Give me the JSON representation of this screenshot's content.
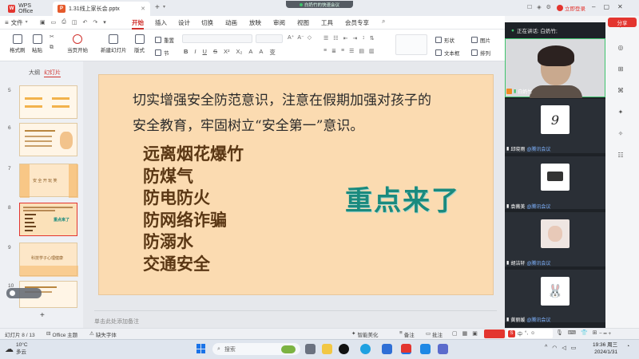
{
  "titlebar": {
    "app_tab": "WPS Office",
    "file_tab": "1.31线上家长会.pptx",
    "meeting_banner": "白奶竹的快速会议",
    "login": "立即登录",
    "share": "分享"
  },
  "menubar": {
    "file": "文件",
    "items": [
      "开始",
      "插入",
      "设计",
      "切换",
      "动画",
      "放映",
      "审阅",
      "视图",
      "工具",
      "会员专享"
    ]
  },
  "ribbon": {
    "format_painter": "格式刷",
    "paste": "粘贴",
    "from_current": "当页开始",
    "new_slide": "新建幻灯片",
    "layout": "版式",
    "reset": "重置",
    "section": "节",
    "shape": "形状",
    "image": "图片",
    "textbox": "文本框",
    "arrange": "排列"
  },
  "leftpane": {
    "tab_outline": "大纲",
    "tab_slides": "幻灯片",
    "slide_numbers": [
      "5",
      "6",
      "7",
      "8",
      "9",
      "10"
    ],
    "thumb7_text": "安 全 开 玩 笑",
    "thumb8_text": "重点来了",
    "thumb9_text": "科技学子心理健康"
  },
  "slide": {
    "paragraph": "切实增强安全防范意识，注意在假期加强对孩子的安全教育，牢固树立“安全第一”意识。",
    "line1": "切实增强安全防范意识，注意在假期加强对孩子的",
    "line2": "安全教育，牢固树立“安全第一”意识。",
    "items": [
      "远离烟花爆竹",
      "防煤气",
      "防电防火",
      "防网络诈骗",
      "防溺水",
      "交通安全"
    ],
    "highlight": "重点来了"
  },
  "notes": {
    "placeholder": "单击此处添加备注"
  },
  "meeting": {
    "speaking_label": "正在讲话: 白奶竹;",
    "host_name": "白奶竹",
    "participants": [
      {
        "name": "邱晓雨",
        "tag": "@腾讯会议"
      },
      {
        "name": "袁薇美",
        "tag": "@腾讯会议"
      },
      {
        "name": "胡洁轩",
        "tag": "@腾讯会议"
      },
      {
        "name": "黄丽媛",
        "tag": "@腾讯会议"
      }
    ]
  },
  "statusbar": {
    "slide_count": "幻灯片 8 / 13",
    "theme": "Office 主题",
    "missing_font": "缺失字体",
    "smart_beautify": "智能美化",
    "notes": "备注",
    "comments": "批注"
  },
  "taskbar": {
    "weather_temp": "10°C",
    "weather_desc": "多云",
    "search": "搜索",
    "time": "19:36 周三",
    "date": "2024/1/31",
    "ime": "中"
  },
  "colors": {
    "slide_bg": "#fbdbb1",
    "item_color": "#5a3714",
    "highlight": "#1a8a7e",
    "accent_red": "#e3352f"
  }
}
